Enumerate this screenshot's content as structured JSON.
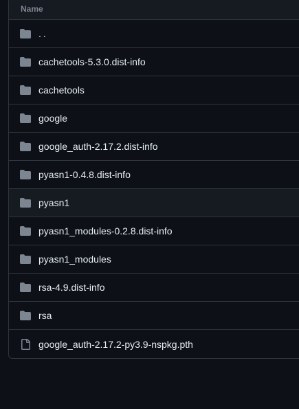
{
  "table": {
    "header": {
      "name_label": "Name"
    },
    "rows": [
      {
        "name": "..",
        "type": "folder"
      },
      {
        "name": "cachetools-5.3.0.dist-info",
        "type": "folder"
      },
      {
        "name": "cachetools",
        "type": "folder"
      },
      {
        "name": "google",
        "type": "folder"
      },
      {
        "name": "google_auth-2.17.2.dist-info",
        "type": "folder"
      },
      {
        "name": "pyasn1-0.4.8.dist-info",
        "type": "folder"
      },
      {
        "name": "pyasn1",
        "type": "folder"
      },
      {
        "name": "pyasn1_modules-0.2.8.dist-info",
        "type": "folder"
      },
      {
        "name": "pyasn1_modules",
        "type": "folder"
      },
      {
        "name": "rsa-4.9.dist-info",
        "type": "folder"
      },
      {
        "name": "rsa",
        "type": "folder"
      },
      {
        "name": "google_auth-2.17.2-py3.9-nspkg.pth",
        "type": "file"
      }
    ]
  },
  "colors": {
    "background": "#0d1117",
    "header_bg": "#161b22",
    "border": "#30363d",
    "text": "#e6edf3",
    "muted": "#7d8590",
    "icon": "#7d8590"
  },
  "icons": {
    "folder": "folder-icon",
    "file": "file-icon"
  }
}
